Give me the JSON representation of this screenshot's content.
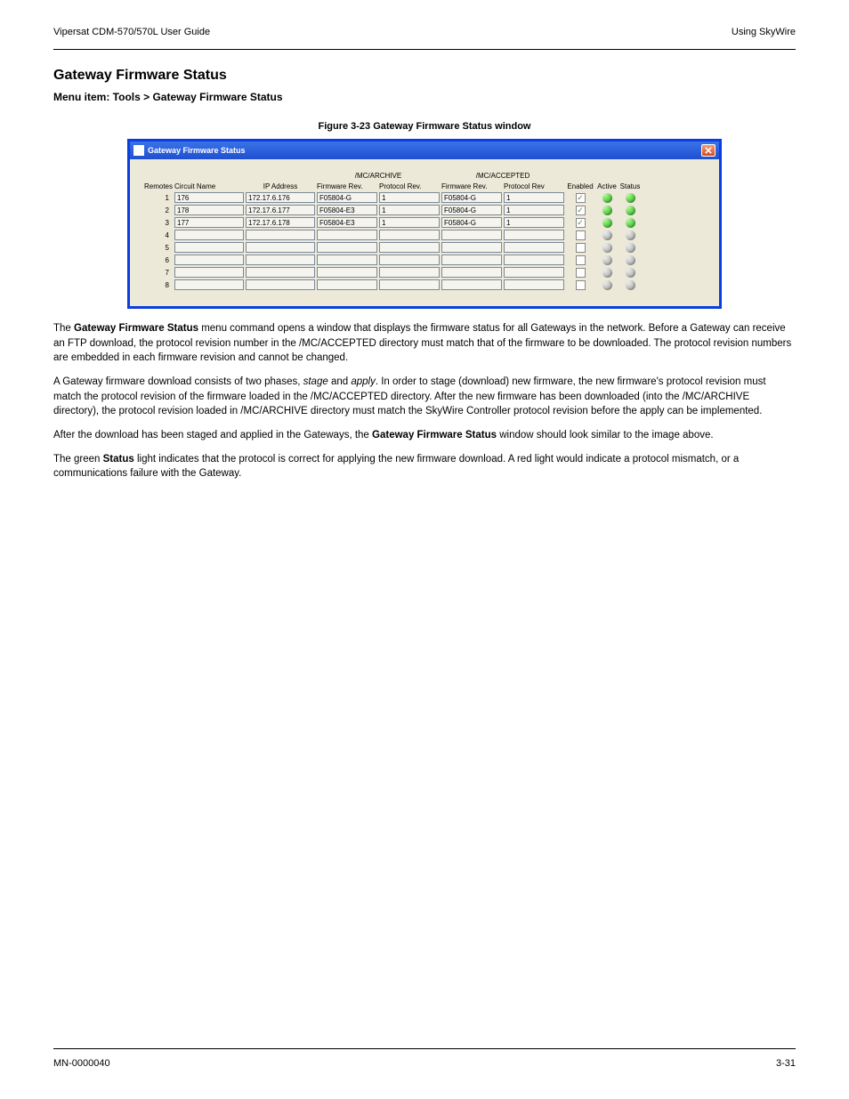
{
  "header": {
    "left": "Vipersat CDM-570/570L User Guide",
    "right": "Using SkyWire"
  },
  "page": {
    "title": "Gateway Firmware Status",
    "subtitle": "Menu item: Tools > Gateway Firmware Status",
    "figure_caption": "Figure 3-23   Gateway Firmware Status window"
  },
  "window": {
    "title": "Gateway Firmware Status"
  },
  "table": {
    "group_headers": {
      "archive": "/MC/ARCHIVE",
      "accepted": "/MC/ACCEPTED"
    },
    "columns": {
      "remotes": "Remotes",
      "circuit": "Circuit Name",
      "ip": "IP Address",
      "fw_rev_a": "Firmware Rev.",
      "proto_rev_a": "Protocol Rev.",
      "fw_rev_b": "Firmware Rev.",
      "proto_rev_b": "Protocol Rev",
      "enabled": "Enabled",
      "active": "Active",
      "status": "Status"
    },
    "rows": [
      {
        "n": "1",
        "circuit": "176",
        "ip": "172.17.6.176",
        "fw_a": "F05804-G",
        "pr_a": "1",
        "fw_b": "F05804-G",
        "pr_b": "1",
        "enabled": true,
        "active": "green",
        "status": "green"
      },
      {
        "n": "2",
        "circuit": "178",
        "ip": "172.17.6.177",
        "fw_a": "F05804-E3",
        "pr_a": "1",
        "fw_b": "F05804-G",
        "pr_b": "1",
        "enabled": true,
        "active": "green",
        "status": "green"
      },
      {
        "n": "3",
        "circuit": "177",
        "ip": "172.17.6.178",
        "fw_a": "F05804-E3",
        "pr_a": "1",
        "fw_b": "F05804-G",
        "pr_b": "1",
        "enabled": true,
        "active": "green",
        "status": "green"
      },
      {
        "n": "4",
        "circuit": "",
        "ip": "",
        "fw_a": "",
        "pr_a": "",
        "fw_b": "",
        "pr_b": "",
        "enabled": false,
        "active": "gray",
        "status": "gray"
      },
      {
        "n": "5",
        "circuit": "",
        "ip": "",
        "fw_a": "",
        "pr_a": "",
        "fw_b": "",
        "pr_b": "",
        "enabled": false,
        "active": "gray",
        "status": "gray"
      },
      {
        "n": "6",
        "circuit": "",
        "ip": "",
        "fw_a": "",
        "pr_a": "",
        "fw_b": "",
        "pr_b": "",
        "enabled": false,
        "active": "gray",
        "status": "gray"
      },
      {
        "n": "7",
        "circuit": "",
        "ip": "",
        "fw_a": "",
        "pr_a": "",
        "fw_b": "",
        "pr_b": "",
        "enabled": false,
        "active": "gray",
        "status": "gray"
      },
      {
        "n": "8",
        "circuit": "",
        "ip": "",
        "fw_a": "",
        "pr_a": "",
        "fw_b": "",
        "pr_b": "",
        "enabled": false,
        "active": "gray",
        "status": "gray"
      }
    ]
  },
  "body": {
    "p1_a": "The ",
    "p1_b": "Gateway Firmware Status",
    "p1_c": " menu command opens a window that displays the firmware status for all Gateways in the network. Before a Gateway can receive an FTP download, the protocol revision number in the /MC/ACCEPTED directory must match that of the firmware to be downloaded. The protocol revision numbers are embedded in each firmware revision and cannot be changed.",
    "p2_a": "A Gateway firmware download consists of two phases, ",
    "p2_b": "stage",
    "p2_c": " and ",
    "p2_d": "apply",
    "p2_e": ". In order to stage (download) new firmware, the new firmware's protocol revision must match the protocol revision of the firmware loaded in the /MC/ACCEPTED directory. After the new firmware has been downloaded (into the /MC/ARCHIVE directory), the protocol revision loaded in /MC/ARCHIVE directory must match the SkyWire Controller protocol revision before the apply can be implemented.",
    "p3_a": "After the download has been staged and applied in the Gateways, the ",
    "p3_b": "Gateway Firmware Status",
    "p3_c": " window should look similar to the image above.",
    "p4_a": "The green ",
    "p4_b": "Status",
    "p4_c": " light indicates that the protocol is correct for applying the new firmware download. A red light would indicate a protocol mismatch, or a communications failure with the Gateway."
  },
  "footer": {
    "left": "MN-0000040",
    "right": "3-31"
  }
}
